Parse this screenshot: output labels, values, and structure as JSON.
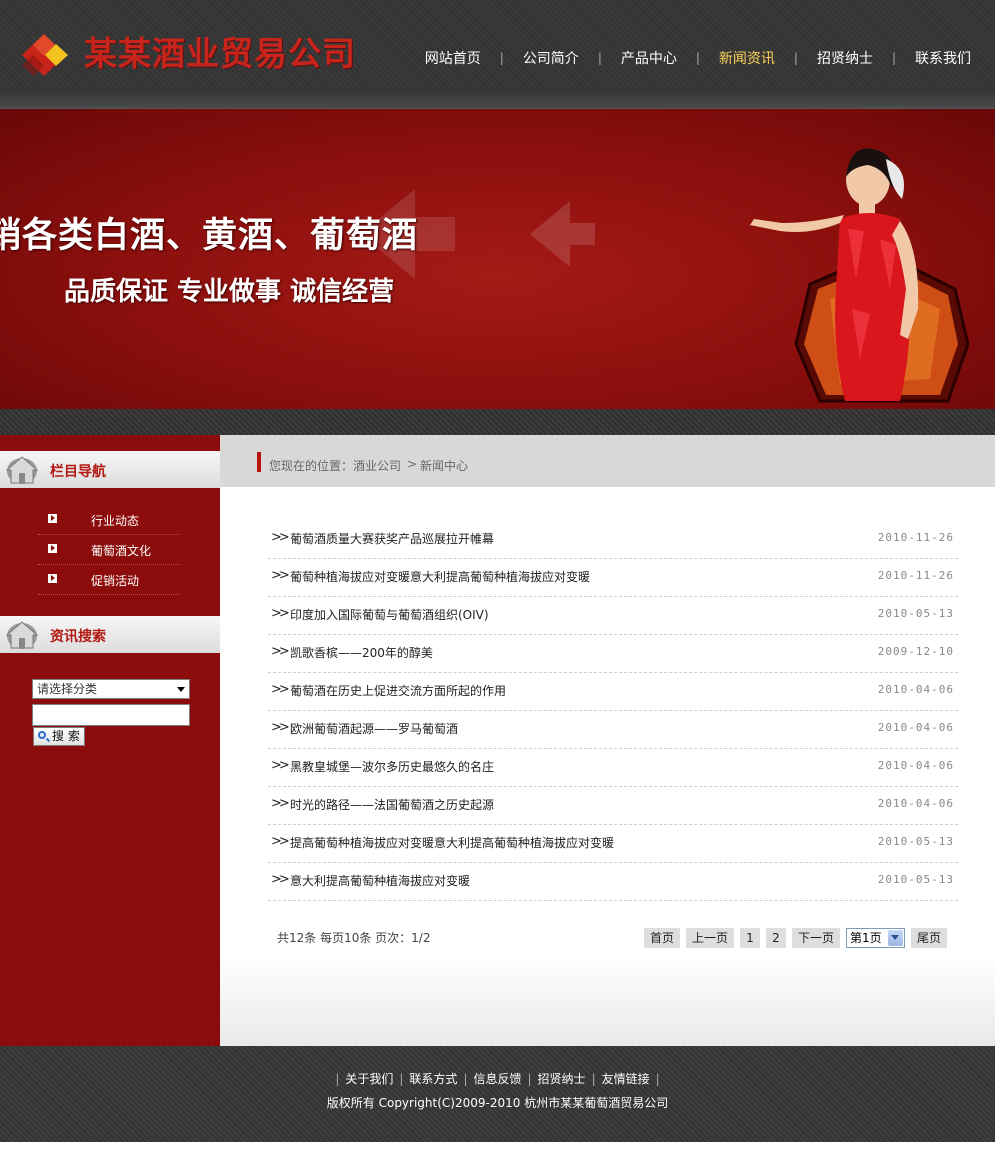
{
  "header": {
    "logo_text": "某某酒业贸易公司",
    "nav": [
      {
        "label": "网站首页",
        "active": false
      },
      {
        "label": "公司简介",
        "active": false
      },
      {
        "label": "产品中心",
        "active": false
      },
      {
        "label": "新闻资讯",
        "active": true
      },
      {
        "label": "招贤纳士",
        "active": false
      },
      {
        "label": "联系我们",
        "active": false
      }
    ],
    "nav_separator": "|",
    "active_color": "#ffd45a"
  },
  "banner": {
    "line1": "销各类白酒、黄酒、葡萄酒",
    "line2": "品质保证 专业做事 诚信经营"
  },
  "sidebar": {
    "nav_title": "栏目导航",
    "menu": [
      "行业动态",
      "葡萄酒文化",
      "促销活动"
    ],
    "search_title": "资讯搜索",
    "category_select": "请选择分类",
    "keyword_value": "",
    "search_button": "搜 索"
  },
  "breadcrumb": {
    "prefix": "您现在的位置：",
    "level1": "酒业公司",
    "separator": ">",
    "level2": "新闻中心"
  },
  "news": [
    {
      "title": "葡萄酒质量大赛获奖产品巡展拉开帷幕",
      "date": "2010-11-26"
    },
    {
      "title": "葡萄种植海拔应对变暖意大利提高葡萄种植海拔应对变暖",
      "date": "2010-11-26"
    },
    {
      "title": "印度加入国际葡萄与葡萄酒组织(OIV)",
      "date": "2010-05-13"
    },
    {
      "title": "凯歌香槟——200年的醇美",
      "date": "2009-12-10"
    },
    {
      "title": "葡萄酒在历史上促进交流方面所起的作用",
      "date": "2010-04-06"
    },
    {
      "title": "欧洲葡萄酒起源——罗马葡萄酒",
      "date": "2010-04-06"
    },
    {
      "title": "黑教皇城堡—波尔多历史最悠久的名庄",
      "date": "2010-04-06"
    },
    {
      "title": "时光的路径——法国葡萄酒之历史起源",
      "date": "2010-04-06"
    },
    {
      "title": "提高葡萄种植海拔应对变暖意大利提高葡萄种植海拔应对变暖",
      "date": "2010-05-13"
    },
    {
      "title": "意大利提高葡萄种植海拔应对变暖",
      "date": "2010-05-13"
    }
  ],
  "pagination": {
    "info": "共12条  每页10条  页次：1/2",
    "first": "首页",
    "prev": "上一页",
    "pages": [
      "1",
      "2"
    ],
    "next": "下一页",
    "page_select": "第1页",
    "last": "尾页"
  },
  "footer": {
    "links": [
      "关于我们",
      "联系方式",
      "信息反馈",
      "招贤纳士",
      "友情链接"
    ],
    "separator": "|",
    "copyright": "版权所有  Copyright(C)2009-2010 杭州市某某葡萄酒贸易公司"
  }
}
